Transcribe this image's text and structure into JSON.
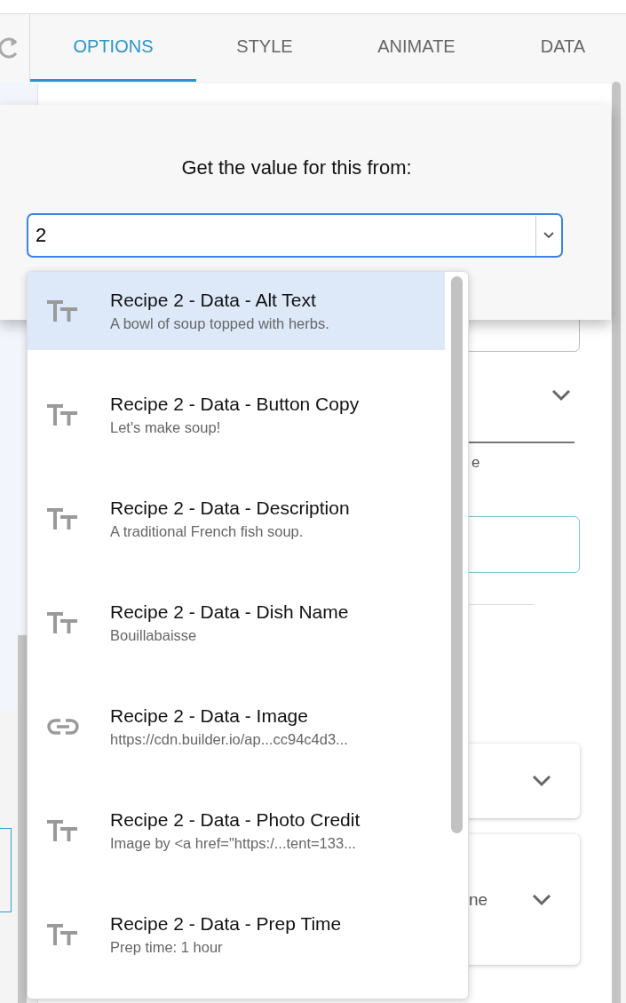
{
  "tabs": [
    {
      "label": "OPTIONS",
      "selected": true
    },
    {
      "label": "STYLE",
      "selected": false
    },
    {
      "label": "ANIMATE",
      "selected": false
    },
    {
      "label": "DATA",
      "selected": false
    }
  ],
  "background": {
    "texts": [
      "e",
      "ne"
    ]
  },
  "dialog": {
    "title": "Get the value for this from:",
    "combobox": {
      "value": "2"
    },
    "options": [
      {
        "kind": "text",
        "label": "Recipe 2 - Data - Alt Text",
        "detail": "A bowl of soup topped with herbs.",
        "selected": true
      },
      {
        "kind": "text",
        "label": "Recipe 2 - Data - Button Copy",
        "detail": "Let's make soup!",
        "selected": false
      },
      {
        "kind": "text",
        "label": "Recipe 2 - Data - Description",
        "detail": "A traditional French fish soup.",
        "selected": false
      },
      {
        "kind": "text",
        "label": "Recipe 2 - Data - Dish Name",
        "detail": "Bouillabaisse",
        "selected": false
      },
      {
        "kind": "link",
        "label": "Recipe 2 - Data - Image",
        "detail": "https://cdn.builder.io/ap...cc94c4d3...",
        "selected": false
      },
      {
        "kind": "text",
        "label": "Recipe 2 - Data - Photo Credit",
        "detail": "Image by <a href=\"https:/...tent=133...",
        "selected": false
      },
      {
        "kind": "text",
        "label": "Recipe 2 - Data - Prep Time",
        "detail": "Prep time: 1 hour",
        "selected": false
      }
    ]
  }
}
